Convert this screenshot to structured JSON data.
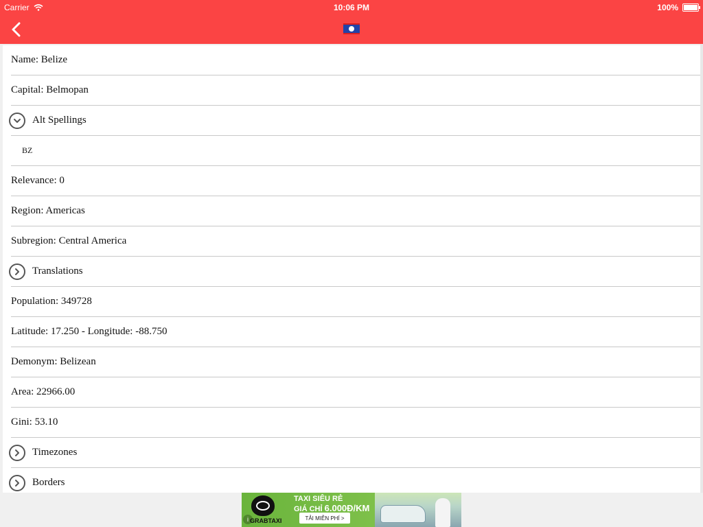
{
  "status": {
    "carrier": "Carrier",
    "time": "10:06 PM",
    "battery": "100%"
  },
  "nav": {
    "back_icon": "chevron-left-icon",
    "flag_icon": "belize-flag-icon"
  },
  "details": {
    "name": "Name: Belize",
    "capital": "Capital: Belmopan",
    "alt_spellings": "Alt Spellings",
    "alt_spelling_item": "BZ",
    "relevance": "Relevance: 0",
    "region": "Region: Americas",
    "subregion": "Subregion: Central America",
    "translations": "Translations",
    "population": "Population: 349728",
    "latlng": "Latitude: 17.250 - Longitude: -88.750",
    "demonym": "Demonym: Belizean",
    "area": "Area: 22966.00",
    "gini": "Gini: 53.10",
    "timezones": "Timezones",
    "borders": "Borders"
  },
  "ad": {
    "line1": "TAXI SIÊU RẺ",
    "line2_prefix": "GIÁ CHỈ ",
    "price": "6.000Đ/KM",
    "cta": "TẢI MIỄN PHÍ >",
    "brand": "GRABTAXI",
    "info": "i"
  },
  "colors": {
    "nav_bar": "#fb4444",
    "ad_green": "#6ab43c"
  }
}
